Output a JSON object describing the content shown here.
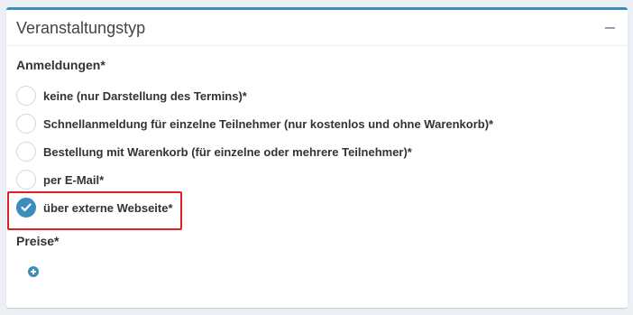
{
  "panel": {
    "title": "Veranstaltungstyp",
    "collapse_icon": "minus-icon"
  },
  "registrations": {
    "label": "Anmeldungen*",
    "options": [
      {
        "label": "keine (nur Darstellung des Termins)*",
        "checked": false
      },
      {
        "label": "Schnellanmeldung für einzelne Teilnehmer (nur kostenlos und ohne Warenkorb)*",
        "checked": false
      },
      {
        "label": "Bestellung mit Warenkorb (für einzelne oder mehrere Teilnehmer)*",
        "checked": false
      },
      {
        "label": "per E-Mail*",
        "checked": false
      },
      {
        "label": "über externe Webseite*",
        "checked": true
      }
    ]
  },
  "prices": {
    "label": "Preise*",
    "add_icon": "plus-circle-icon"
  },
  "colors": {
    "accent": "#3c8dbc",
    "highlight": "#e21e26"
  }
}
